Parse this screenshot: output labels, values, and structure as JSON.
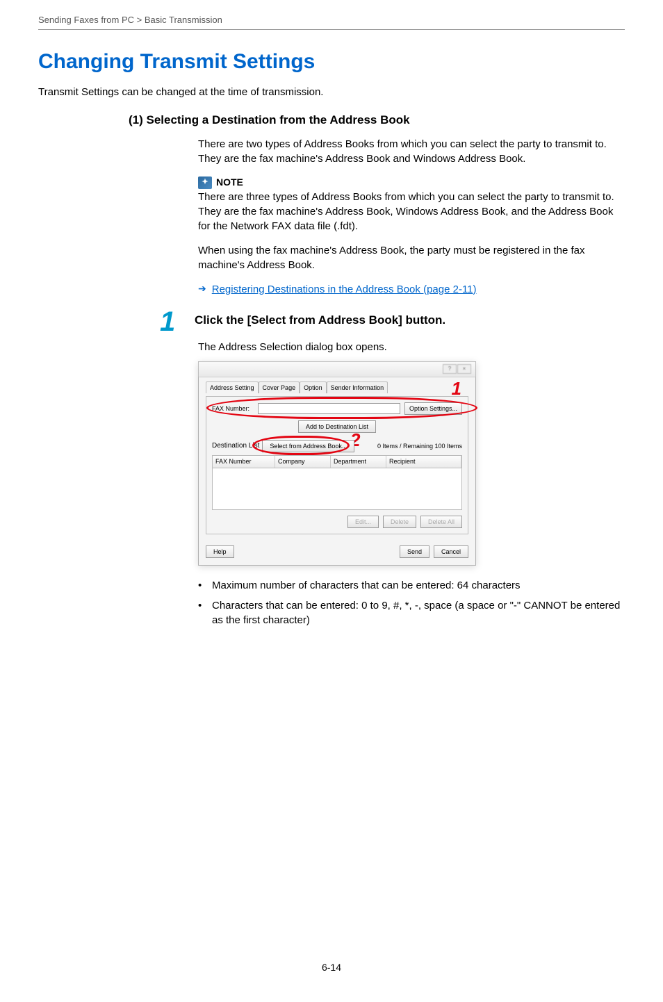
{
  "breadcrumb": "Sending Faxes from PC > Basic Transmission",
  "title": "Changing Transmit Settings",
  "intro": "Transmit Settings can be changed at the time of transmission.",
  "subhead": "(1) Selecting a Destination from the Address Book",
  "para1": "There are two types of Address Books from which you can select the party to transmit to. They are the fax machine's Address Book and Windows Address Book.",
  "note_label": "NOTE",
  "note_body": "There are three types of Address Books from which you can select the party to transmit to. They are the fax machine's Address Book, Windows Address Book, and the Address Book for the Network FAX data file (.fdt).",
  "para2": "When using the fax machine's Address Book, the party must be registered in the fax machine's Address Book.",
  "link_text": "Registering Destinations in the Address Book (page 2-11)",
  "step_num": "1",
  "step_title": "Click the [Select from Address Book] button.",
  "step_body": "The Address Selection dialog box opens.",
  "dialog": {
    "tabs": [
      "Address Setting",
      "Cover Page",
      "Option",
      "Sender Information"
    ],
    "fax_label": "FAX Number:",
    "option_settings_btn": "Option Settings...",
    "add_dest_btn": "Add to Destination List",
    "dest_label": "Destination List",
    "select_btn": "Select from Address Book...",
    "remaining": "0 Items / Remaining 100 Items",
    "cols": [
      "FAX Number",
      "Company",
      "Department",
      "Recipient"
    ],
    "edit_btn": "Edit...",
    "delete_btn": "Delete",
    "delete_all_btn": "Delete All",
    "help_btn": "Help",
    "send_btn": "Send",
    "cancel_btn": "Cancel",
    "callout1": "1",
    "callout2": "2"
  },
  "bullets": [
    "Maximum number of characters that can be entered: 64 characters",
    "Characters that can be entered: 0 to 9, #, *, -, space (a space or \"-\" CANNOT be entered as the first character)"
  ],
  "page_number": "6-14"
}
